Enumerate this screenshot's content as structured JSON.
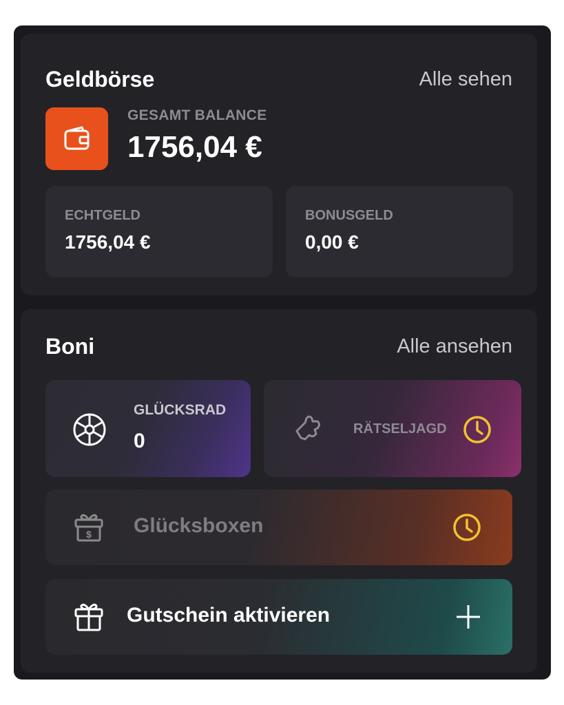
{
  "wallet": {
    "title": "Geldbörse",
    "see_all": "Alle sehen",
    "icon": "wallet-icon",
    "balance_label": "GESAMT BALANCE",
    "balance_value": "1756,04 €",
    "real_money": {
      "label": "ECHTGELD",
      "value": "1756,04 €"
    },
    "bonus_money": {
      "label": "BONUSGELD",
      "value": "0,00 €"
    }
  },
  "boni": {
    "title": "Boni",
    "see_all": "Alle ansehen",
    "wheel": {
      "label": "GLÜCKSRAD",
      "value": "0",
      "icon": "wheel-icon"
    },
    "puzzle": {
      "label": "RÄTSELJAGD",
      "icon": "puzzle-icon",
      "status_icon": "clock-icon"
    },
    "boxes": {
      "label": "Glücksboxen",
      "icon": "gift-box-icon",
      "status_icon": "clock-icon"
    },
    "voucher": {
      "label": "Gutschein aktivieren",
      "icon": "gift-icon",
      "action_icon": "plus-icon"
    }
  },
  "colors": {
    "accent_orange": "#e8511c",
    "clock_yellow": "#f2c230",
    "panel_bg": "#1a191d",
    "card_bg": "#232227"
  }
}
